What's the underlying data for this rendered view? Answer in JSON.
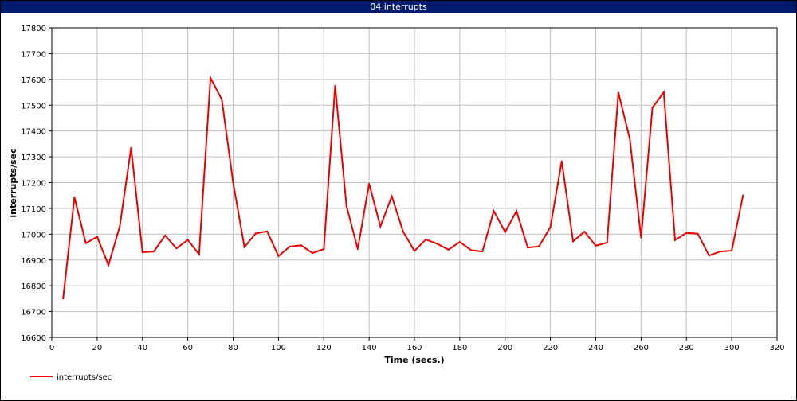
{
  "window": {
    "title": "04 interrupts"
  },
  "colors": {
    "titlebar": "#001a6e",
    "series": "#ee0000",
    "grid": "#c0c0c0"
  },
  "chart_data": {
    "type": "line",
    "title": "04 interrupts",
    "xlabel": "Time (secs.)",
    "ylabel": "interrupts/sec",
    "xlim": [
      0,
      320
    ],
    "ylim": [
      16600,
      17800
    ],
    "xticks": [
      0,
      20,
      40,
      60,
      80,
      100,
      120,
      140,
      160,
      180,
      200,
      220,
      240,
      260,
      280,
      300,
      320
    ],
    "yticks": [
      16600,
      16700,
      16800,
      16900,
      17000,
      17100,
      17200,
      17300,
      17400,
      17500,
      17600,
      17700,
      17800
    ],
    "grid": true,
    "legend_position": "bottom-left",
    "series": [
      {
        "name": "interrupts/sec",
        "color": "#ee0000",
        "x": [
          5,
          10,
          15,
          20,
          25,
          30,
          35,
          40,
          45,
          50,
          55,
          60,
          65,
          70,
          75,
          80,
          85,
          90,
          95,
          100,
          105,
          110,
          115,
          120,
          125,
          130,
          135,
          140,
          145,
          150,
          155,
          160,
          165,
          170,
          175,
          180,
          185,
          190,
          195,
          200,
          205,
          210,
          215,
          220,
          225,
          230,
          235,
          240,
          245,
          250,
          255,
          260,
          265,
          270,
          275,
          280,
          285,
          290,
          295,
          300,
          305
        ],
        "y": [
          16750,
          17143,
          16965,
          16990,
          16880,
          17030,
          17335,
          16930,
          16933,
          16995,
          16945,
          16978,
          16922,
          17606,
          17522,
          17200,
          16950,
          17003,
          17011,
          16915,
          16952,
          16957,
          16927,
          16942,
          17575,
          17110,
          16942,
          17196,
          17030,
          17147,
          17010,
          16935,
          16979,
          16963,
          16940,
          16970,
          16938,
          16933,
          17090,
          17008,
          17090,
          16948,
          16953,
          17028,
          17283,
          16972,
          17010,
          16955,
          16967,
          17549,
          17370,
          16986,
          17490,
          17550,
          16977,
          17005,
          17002,
          16917,
          16933,
          16936,
          17151
        ]
      }
    ]
  }
}
